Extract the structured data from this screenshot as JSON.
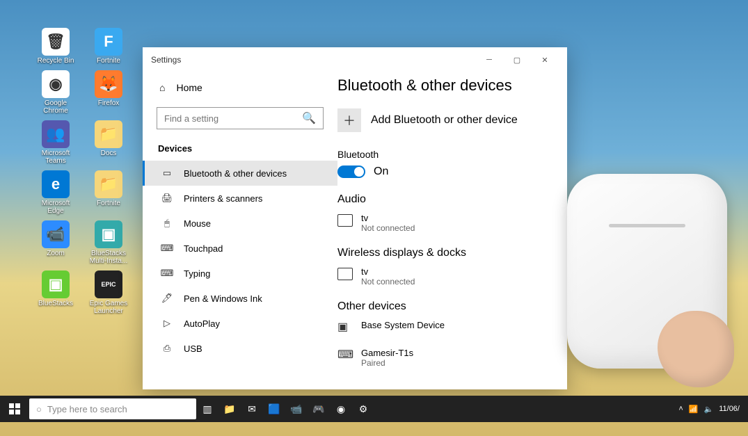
{
  "desktop": {
    "icons": [
      {
        "label": "Recycle Bin",
        "bg": "#fff",
        "glyph": "🗑"
      },
      {
        "label": "Fortnite",
        "bg": "#3aa9f0",
        "glyph": "F"
      },
      {
        "label": "Google Chrome",
        "bg": "#fff",
        "glyph": "◉"
      },
      {
        "label": "Firefox",
        "bg": "#ff7b2e",
        "glyph": "🦊"
      },
      {
        "label": "Microsoft Teams",
        "bg": "#5558af",
        "glyph": "👥"
      },
      {
        "label": "Docs",
        "bg": "#f6d67a",
        "glyph": "📁"
      },
      {
        "label": "Microsoft Edge",
        "bg": "#0078d4",
        "glyph": "e"
      },
      {
        "label": "Fortnite",
        "bg": "#f6d67a",
        "glyph": "📁"
      },
      {
        "label": "Zoom",
        "bg": "#2d8cff",
        "glyph": "📹"
      },
      {
        "label": "BlueStacks Multi-Insta...",
        "bg": "#3aa",
        "glyph": "▣"
      },
      {
        "label": "BlueStacks",
        "bg": "#6c3",
        "glyph": "▣"
      },
      {
        "label": "Epic Games Launcher",
        "bg": "#222",
        "glyph": "EPIC"
      }
    ]
  },
  "window": {
    "title": "Settings",
    "home": "Home",
    "search_placeholder": "Find a setting",
    "section": "Devices",
    "nav": [
      {
        "label": "Bluetooth & other devices",
        "selected": true
      },
      {
        "label": "Printers & scanners",
        "selected": false
      },
      {
        "label": "Mouse",
        "selected": false
      },
      {
        "label": "Touchpad",
        "selected": false
      },
      {
        "label": "Typing",
        "selected": false
      },
      {
        "label": "Pen & Windows Ink",
        "selected": false
      },
      {
        "label": "AutoPlay",
        "selected": false
      },
      {
        "label": "USB",
        "selected": false
      }
    ],
    "page_title": "Bluetooth & other devices",
    "add_label": "Add Bluetooth or other device",
    "bt_heading": "Bluetooth",
    "bt_state": "On",
    "audio_heading": "Audio",
    "audio_device": {
      "name": "tv",
      "status": "Not connected"
    },
    "wireless_heading": "Wireless displays & docks",
    "wireless_device": {
      "name": "tv",
      "status": "Not connected"
    },
    "other_heading": "Other devices",
    "other_devices": [
      {
        "name": "Base System Device",
        "status": ""
      },
      {
        "name": "Gamesir-T1s",
        "status": "Paired"
      }
    ]
  },
  "taskbar": {
    "search_placeholder": "Type here to search",
    "date": "11/06/"
  }
}
